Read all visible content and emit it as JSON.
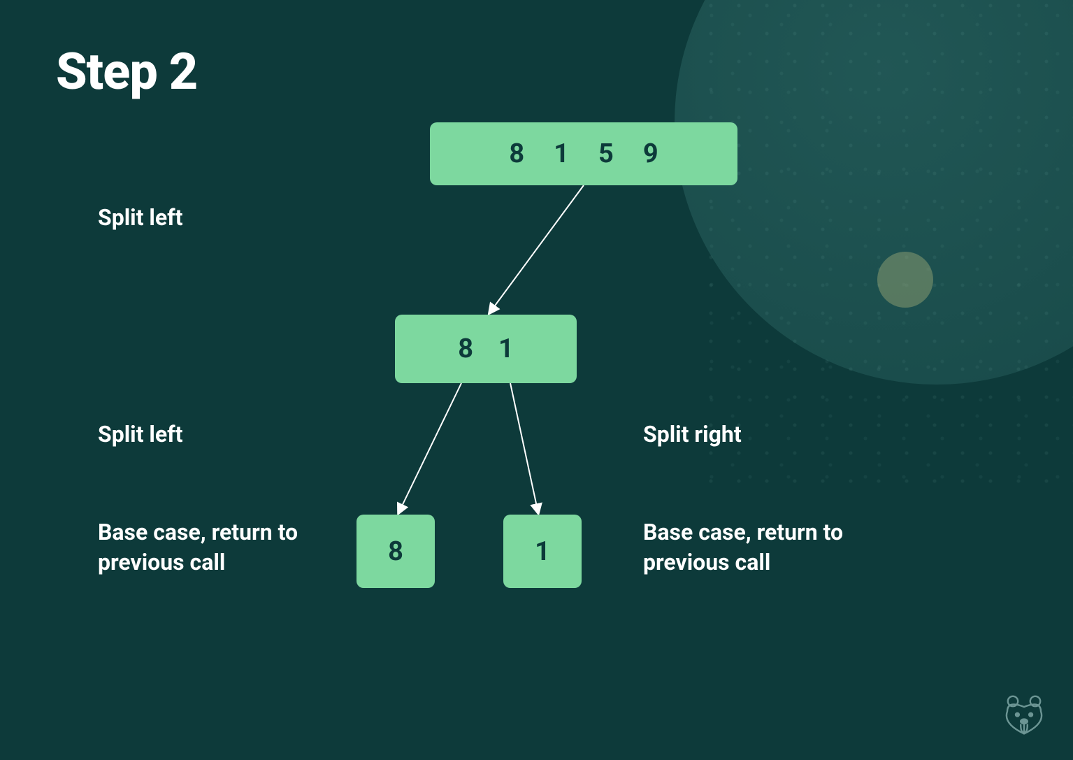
{
  "title": "Step 2",
  "colors": {
    "background": "#0d3a3a",
    "node_fill": "#7dd89f",
    "node_text": "#0d3a3a",
    "text": "#ffffff",
    "arrow": "#ffffff"
  },
  "tree": {
    "root": {
      "values": [
        8,
        1,
        5,
        9
      ]
    },
    "mid": {
      "values": [
        8,
        1
      ]
    },
    "leaves": {
      "left": {
        "value": 8
      },
      "right": {
        "value": 1
      }
    }
  },
  "labels": {
    "left_level1": "Split left",
    "left_level2": "Split left",
    "left_level3": "Base case, return to previous call",
    "right_level2": "Split right",
    "right_level3": "Base case, return to previous call"
  },
  "edges": [
    {
      "from": "root",
      "to": "mid"
    },
    {
      "from": "mid",
      "to": "leaf-left"
    },
    {
      "from": "mid",
      "to": "leaf-right"
    }
  ],
  "mascot_icon": "beaver-logo"
}
